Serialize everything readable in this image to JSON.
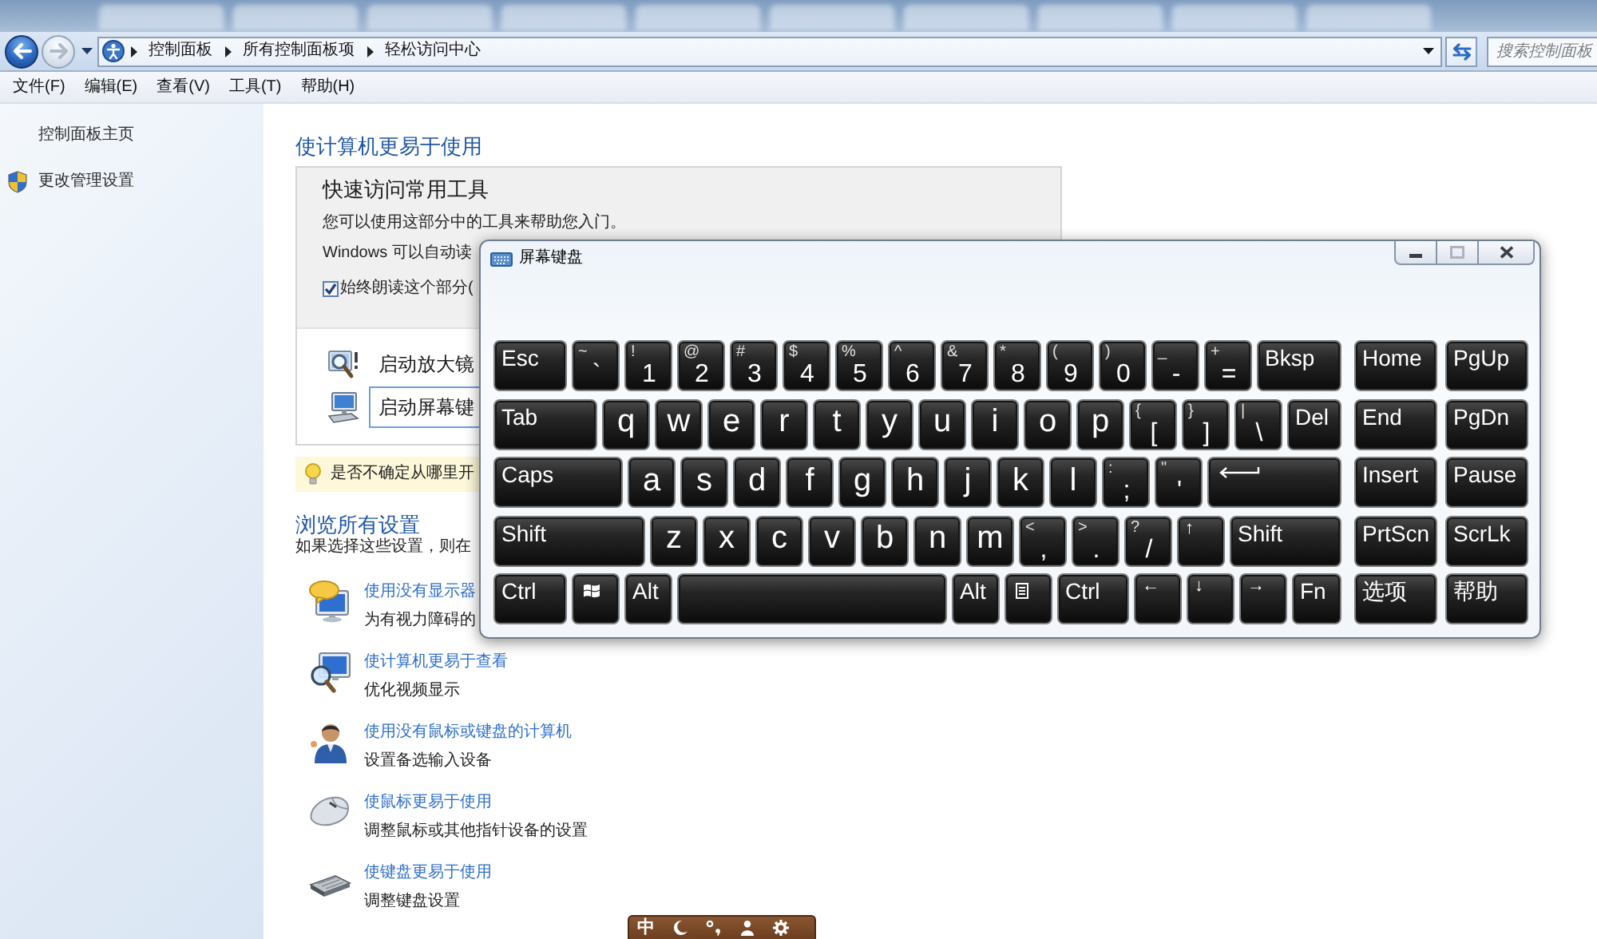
{
  "navigation": {
    "back": {
      "disabled": false
    },
    "forward": {
      "disabled": true
    },
    "breadcrumbs": [
      "控制面板",
      "所有控制面板项",
      "轻松访问中心"
    ],
    "search": {
      "placeholder": "搜索控制面板"
    }
  },
  "menu": [
    "文件(F)",
    "编辑(E)",
    "查看(V)",
    "工具(T)",
    "帮助(H)"
  ],
  "sidebar": {
    "items": [
      {
        "kind": "link",
        "label": "控制面板主页"
      },
      {
        "kind": "shield",
        "label": "更改管理设置"
      }
    ]
  },
  "main": {
    "heading": "使计算机更易于使用",
    "quick_access": {
      "title": "快速访问常用工具",
      "intro": "您可以使用这部分中的工具来帮助您入门。",
      "narration": "Windows 可以自动读",
      "always_read": {
        "label": "始终朗读这个部分(",
        "checked": true
      },
      "tools": [
        {
          "kind": "magnifier",
          "label": "启动放大镜",
          "focused": false
        },
        {
          "kind": "on_screen_keyboard",
          "label": "启动屏幕键",
          "focused": true
        }
      ]
    },
    "tip": {
      "text": "是否不确定从哪里开"
    },
    "browse": {
      "heading": "浏览所有设置",
      "intro": "如果选择这些设置，则在",
      "items": [
        {
          "kind": "no_display",
          "link": "使用没有显示器",
          "description": "为有视力障碍的"
        },
        {
          "kind": "easier_to_see",
          "link": "使计算机更易于查看",
          "description": "优化视频显示"
        },
        {
          "kind": "no_mouse_keyboard",
          "link": "使用没有鼠标或键盘的计算机",
          "description": "设置备选输入设备"
        },
        {
          "kind": "mouse",
          "link": "使鼠标更易于使用",
          "description": "调整鼠标或其他指针设备的设置"
        },
        {
          "kind": "keyboard",
          "link": "使键盘更易于使用",
          "description": "调整键盘设置"
        }
      ]
    }
  },
  "osk": {
    "title": "屏幕键盘",
    "maximize": {
      "disabled": true
    },
    "main_rows": [
      [
        {
          "kind": "label",
          "label": "Esc"
        },
        {
          "kind": "dual",
          "shift": "~",
          "main": "`"
        },
        {
          "kind": "dual",
          "shift": "!",
          "main": "1"
        },
        {
          "kind": "dual",
          "shift": "@",
          "main": "2"
        },
        {
          "kind": "dual",
          "shift": "#",
          "main": "3"
        },
        {
          "kind": "dual",
          "shift": "$",
          "main": "4"
        },
        {
          "kind": "dual",
          "shift": "%",
          "main": "5"
        },
        {
          "kind": "dual",
          "shift": "^",
          "main": "6"
        },
        {
          "kind": "dual",
          "shift": "&",
          "main": "7"
        },
        {
          "kind": "dual",
          "shift": "*",
          "main": "8"
        },
        {
          "kind": "dual",
          "shift": "(",
          "main": "9"
        },
        {
          "kind": "dual",
          "shift": ")",
          "main": "0"
        },
        {
          "kind": "dual",
          "shift": "_",
          "main": "-"
        },
        {
          "kind": "dual",
          "shift": "+",
          "main": "="
        },
        {
          "kind": "label",
          "label": "Bksp"
        }
      ],
      [
        {
          "kind": "label",
          "label": "Tab"
        },
        {
          "kind": "letter",
          "label": "q"
        },
        {
          "kind": "letter",
          "label": "w"
        },
        {
          "kind": "letter",
          "label": "e"
        },
        {
          "kind": "letter",
          "label": "r"
        },
        {
          "kind": "letter",
          "label": "t"
        },
        {
          "kind": "letter",
          "label": "y"
        },
        {
          "kind": "letter",
          "label": "u"
        },
        {
          "kind": "letter",
          "label": "i"
        },
        {
          "kind": "letter",
          "label": "o"
        },
        {
          "kind": "letter",
          "label": "p"
        },
        {
          "kind": "dual",
          "shift": "{",
          "main": "["
        },
        {
          "kind": "dual",
          "shift": "}",
          "main": "]"
        },
        {
          "kind": "dual",
          "shift": "|",
          "main": "\\"
        },
        {
          "kind": "label",
          "label": "Del"
        }
      ],
      [
        {
          "kind": "label",
          "label": "Caps"
        },
        {
          "kind": "letter",
          "label": "a"
        },
        {
          "kind": "letter",
          "label": "s"
        },
        {
          "kind": "letter",
          "label": "d"
        },
        {
          "kind": "letter",
          "label": "f"
        },
        {
          "kind": "letter",
          "label": "g"
        },
        {
          "kind": "letter",
          "label": "h"
        },
        {
          "kind": "letter",
          "label": "j"
        },
        {
          "kind": "letter",
          "label": "k"
        },
        {
          "kind": "letter",
          "label": "l"
        },
        {
          "kind": "dual",
          "shift": ":",
          "main": ";"
        },
        {
          "kind": "dual",
          "shift": "\"",
          "main": "'"
        },
        {
          "kind": "enter"
        }
      ],
      [
        {
          "kind": "label",
          "label": "Shift"
        },
        {
          "kind": "letter",
          "label": "z"
        },
        {
          "kind": "letter",
          "label": "x"
        },
        {
          "kind": "letter",
          "label": "c"
        },
        {
          "kind": "letter",
          "label": "v"
        },
        {
          "kind": "letter",
          "label": "b"
        },
        {
          "kind": "letter",
          "label": "n"
        },
        {
          "kind": "letter",
          "label": "m"
        },
        {
          "kind": "dual",
          "shift": "<",
          "main": ","
        },
        {
          "kind": "dual",
          "shift": ">",
          "main": "."
        },
        {
          "kind": "dual",
          "shift": "?",
          "main": "/"
        },
        {
          "kind": "arrow",
          "label": "↑"
        },
        {
          "kind": "label",
          "label": "Shift"
        }
      ],
      [
        {
          "kind": "label",
          "label": "Ctrl"
        },
        {
          "kind": "windows"
        },
        {
          "kind": "label",
          "label": "Alt"
        },
        {
          "kind": "space"
        },
        {
          "kind": "label",
          "label": "Alt"
        },
        {
          "kind": "menu"
        },
        {
          "kind": "label",
          "label": "Ctrl"
        },
        {
          "kind": "arrow",
          "label": "←"
        },
        {
          "kind": "arrow",
          "label": "↓"
        },
        {
          "kind": "arrow",
          "label": "→"
        },
        {
          "kind": "label",
          "label": "Fn"
        }
      ]
    ],
    "side_rows": [
      [
        {
          "kind": "label",
          "label": "Home"
        },
        {
          "kind": "label",
          "label": "PgUp"
        }
      ],
      [
        {
          "kind": "label",
          "label": "End"
        },
        {
          "kind": "label",
          "label": "PgDn"
        }
      ],
      [
        {
          "kind": "label",
          "label": "Insert"
        },
        {
          "kind": "label",
          "label": "Pause"
        }
      ],
      [
        {
          "kind": "label",
          "label": "PrtScn"
        },
        {
          "kind": "label",
          "label": "ScrLk"
        }
      ],
      [
        {
          "kind": "label",
          "label": "选项"
        },
        {
          "kind": "label",
          "label": "帮助"
        }
      ]
    ]
  },
  "ime_toolbar": {
    "mode": "中"
  }
}
